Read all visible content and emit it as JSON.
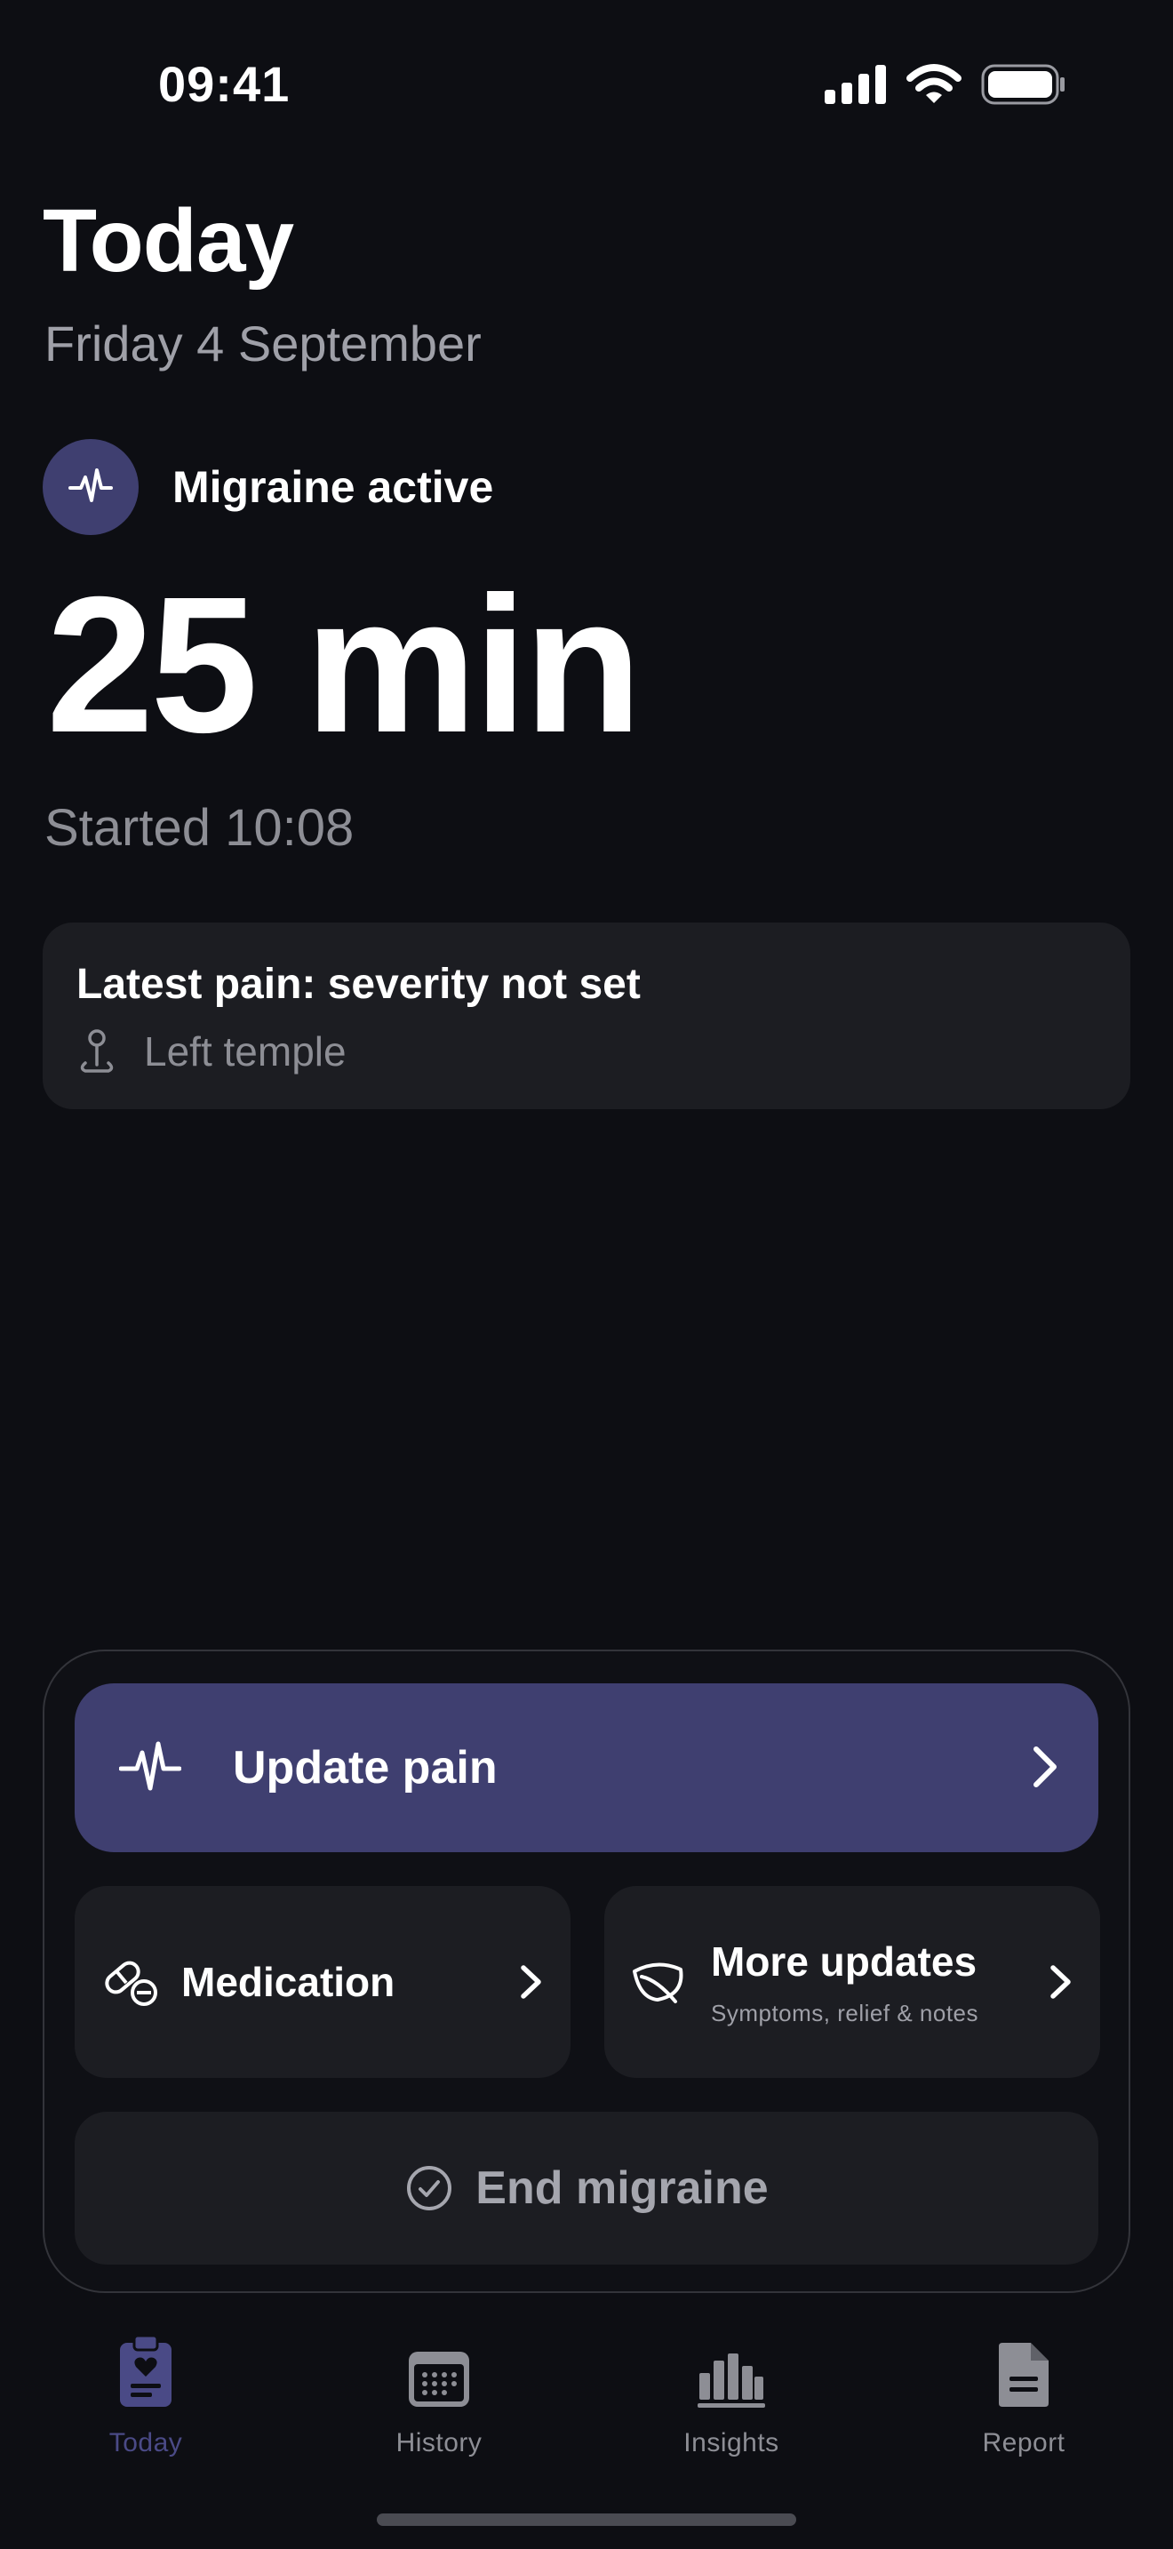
{
  "status_bar": {
    "time": "09:41",
    "icons": [
      "cellular-signal-icon",
      "wifi-icon",
      "battery-icon"
    ]
  },
  "header": {
    "title": "Today",
    "date": "Friday 4 September"
  },
  "episode": {
    "status_label": "Migraine active",
    "status_icon": "heartbeat-icon",
    "duration": "25 min",
    "started": "Started 10:08"
  },
  "latest_pain": {
    "title": "Latest pain: severity not set",
    "location": "Left temple",
    "location_icon": "map-pin-icon"
  },
  "actions": {
    "update_pain": {
      "label": "Update pain",
      "icon": "heartbeat-icon"
    },
    "medication": {
      "label": "Medication",
      "icon": "pill-icon"
    },
    "more_updates": {
      "label": "More updates",
      "sublabel": "Symptoms, relief & notes",
      "icon": "leaf-icon"
    },
    "end_migraine": {
      "label": "End migraine",
      "icon": "check-circle-icon"
    }
  },
  "tabs": [
    {
      "label": "Today",
      "icon": "clipboard-heart-icon",
      "active": true
    },
    {
      "label": "History",
      "icon": "calendar-icon",
      "active": false
    },
    {
      "label": "Insights",
      "icon": "bar-chart-icon",
      "active": false
    },
    {
      "label": "Report",
      "icon": "document-icon",
      "active": false
    }
  ],
  "colors": {
    "background": "#0d0e13",
    "card": "#1c1d22",
    "accent": "#3f3f70",
    "active_tab": "#4a4a86",
    "muted_text": "#8d8e95"
  }
}
